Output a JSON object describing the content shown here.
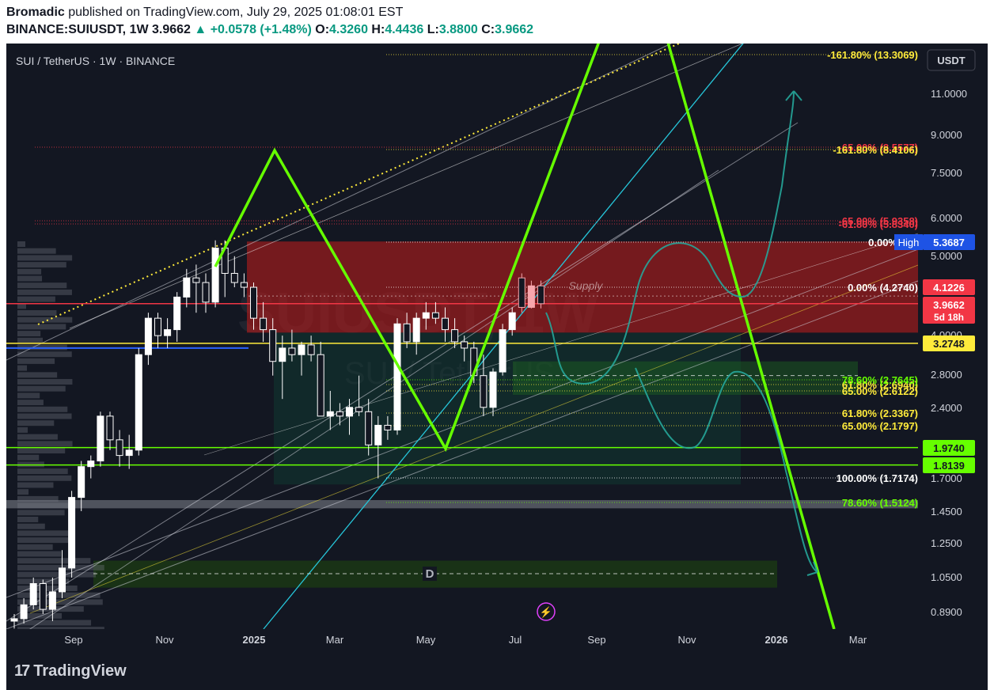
{
  "header": {
    "publisher": "Bromadic",
    "published_text": "published on TradingView.com, July 29, 2025 01:08:01 EST",
    "symbol": "BINANCE:SUIUSDT, 1W",
    "price": "3.9662",
    "change": "+0.0578 (+1.48%)",
    "o_label": "O:",
    "o": "4.3260",
    "h_label": "H:",
    "h": "4.4436",
    "l_label": "L:",
    "l": "3.8800",
    "c_label": "C:",
    "c": "3.9662"
  },
  "chart_title": "SUI / TetherUS · 1W · BINANCE",
  "currency_button": "USDT",
  "watermark": "SUIUSDT, 1W",
  "watermark_sub": "SUI / TetherUS",
  "supply_label": "Supply",
  "d_label": "D",
  "colors": {
    "bg": "#131722",
    "up": "#ffffff",
    "down": "#ffffff",
    "recent_up": "#f7525f",
    "green": "#66ff00",
    "yellow": "#ffeb3b",
    "red": "#f23645",
    "teal": "#26c6da",
    "blue": "#2962ff",
    "text": "#d1d4dc"
  },
  "chart_data": {
    "type": "candlestick",
    "y_scale": "log",
    "ylim": [
      0.85,
      14.0
    ],
    "y_ticks": [
      "11.0000",
      "9.0000",
      "7.5000",
      "6.0000",
      "5.0000",
      "4.0000",
      "2.8000",
      "2.4000",
      "1.7000",
      "1.4500",
      "1.2500",
      "1.0500",
      "0.8900"
    ],
    "x_ticks": [
      "Sep",
      "Nov",
      "2025",
      "Mar",
      "May",
      "Jul",
      "Sep",
      "Nov",
      "2026",
      "Mar"
    ],
    "x_ticks_bold": [
      "2025",
      "2026"
    ],
    "candles": [
      [
        0.85,
        0.88,
        0.82,
        0.86
      ],
      [
        0.86,
        0.95,
        0.84,
        0.92
      ],
      [
        0.92,
        1.05,
        0.9,
        1.02
      ],
      [
        1.02,
        1.04,
        0.88,
        0.9
      ],
      [
        0.9,
        1.05,
        0.85,
        0.98
      ],
      [
        0.98,
        1.2,
        0.95,
        1.1
      ],
      [
        1.1,
        1.6,
        1.05,
        1.55
      ],
      [
        1.55,
        1.85,
        1.45,
        1.8
      ],
      [
        1.8,
        1.9,
        1.7,
        1.85
      ],
      [
        1.85,
        2.35,
        1.8,
        2.3
      ],
      [
        2.3,
        2.35,
        1.95,
        2.05
      ],
      [
        2.05,
        2.15,
        1.8,
        1.9
      ],
      [
        1.9,
        2.1,
        1.78,
        1.95
      ],
      [
        1.95,
        3.2,
        1.9,
        3.1
      ],
      [
        3.1,
        3.8,
        2.95,
        3.7
      ],
      [
        3.7,
        3.8,
        3.2,
        3.4
      ],
      [
        3.4,
        3.7,
        3.2,
        3.5
      ],
      [
        3.5,
        4.2,
        3.3,
        4.1
      ],
      [
        4.1,
        4.7,
        3.9,
        4.5
      ],
      [
        4.5,
        4.8,
        3.8,
        4.4
      ],
      [
        4.4,
        4.6,
        3.8,
        4.0
      ],
      [
        4.0,
        5.4,
        3.9,
        5.2
      ],
      [
        5.2,
        5.4,
        4.1,
        4.6
      ],
      [
        4.6,
        5.0,
        4.3,
        4.4
      ],
      [
        4.4,
        4.6,
        4.1,
        4.3
      ],
      [
        4.3,
        4.4,
        3.5,
        3.7
      ],
      [
        3.7,
        4.0,
        3.3,
        3.5
      ],
      [
        3.5,
        3.7,
        2.8,
        3.0
      ],
      [
        3.0,
        3.4,
        2.5,
        3.2
      ],
      [
        3.2,
        3.5,
        3.0,
        3.1
      ],
      [
        3.1,
        3.3,
        2.8,
        3.25
      ],
      [
        3.25,
        3.4,
        3.0,
        3.1
      ],
      [
        3.1,
        3.3,
        2.5,
        2.3
      ],
      [
        2.3,
        2.6,
        2.15,
        2.35
      ],
      [
        2.35,
        2.45,
        2.2,
        2.3
      ],
      [
        2.3,
        2.5,
        2.1,
        2.4
      ],
      [
        2.4,
        2.8,
        2.3,
        2.35
      ],
      [
        2.35,
        2.5,
        1.9,
        2.0
      ],
      [
        2.0,
        2.3,
        1.7,
        2.2
      ],
      [
        2.2,
        2.3,
        2.05,
        2.15
      ],
      [
        2.15,
        3.7,
        2.1,
        3.6
      ],
      [
        3.6,
        3.8,
        3.2,
        3.3
      ],
      [
        3.3,
        3.8,
        3.1,
        3.7
      ],
      [
        3.7,
        4.0,
        3.5,
        3.8
      ],
      [
        3.8,
        4.0,
        3.6,
        3.7
      ],
      [
        3.7,
        3.9,
        3.3,
        3.5
      ],
      [
        3.5,
        3.7,
        3.2,
        3.3
      ],
      [
        3.3,
        3.4,
        3.0,
        3.2
      ],
      [
        3.2,
        3.3,
        2.7,
        2.8
      ],
      [
        2.8,
        3.1,
        2.3,
        2.4
      ],
      [
        2.4,
        2.9,
        2.3,
        2.85
      ],
      [
        2.85,
        3.6,
        2.8,
        3.5
      ],
      [
        3.5,
        3.9,
        3.4,
        3.8
      ],
      [
        4.5,
        4.6,
        3.8,
        3.9
      ],
      [
        3.9,
        4.44,
        3.88,
        4.33
      ],
      [
        4.33,
        4.44,
        3.88,
        3.97
      ]
    ],
    "price_labels": [
      {
        "text": "5.3687",
        "value": 5.3687,
        "bg": "#1e53e5",
        "tag": "High"
      },
      {
        "text": "4.1226",
        "value": 4.1226,
        "bg": "#f23645",
        "tag": ""
      },
      {
        "text": "3.9662",
        "value": 3.9662,
        "bg": "#f23645",
        "tag": "5d 18h"
      },
      {
        "text": "3.2748",
        "value": 3.2748,
        "bg": "#ffeb3b",
        "tag": ""
      },
      {
        "text": "1.9740",
        "value": 1.974,
        "bg": "#66ff00",
        "tag": ""
      },
      {
        "text": "1.8139",
        "value": 1.8139,
        "bg": "#66ff00",
        "tag": ""
      }
    ],
    "fib_levels": [
      {
        "text": "-161.80% (13.3069)",
        "value": 13.3069,
        "color": "#ffeb3b"
      },
      {
        "text": "-65.00% (8.5577)",
        "value": 8.5577,
        "color": "#f23645"
      },
      {
        "text": "-161.80% (8.4106)",
        "value": 8.4106,
        "color": "#ffeb3b"
      },
      {
        "text": "-65.00% (5.9358)",
        "value": 5.9358,
        "color": "#f23645"
      },
      {
        "text": "-61.80% (5.8340)",
        "value": 5.834,
        "color": "#f23645"
      },
      {
        "text": "0.00% (5.3",
        "value": 5.3687,
        "color": "#ffffff"
      },
      {
        "text": "0.00% (4.2740)",
        "value": 4.274,
        "color": "#ffffff"
      },
      {
        "text": "61.80% (2.6940)",
        "value": 2.694,
        "color": "#ffeb3b"
      },
      {
        "text": "78.60% (2.7645)",
        "value": 2.7645,
        "color": "#66ff00"
      },
      {
        "text": "65.00% (2.6122)",
        "value": 2.6122,
        "color": "#ffeb3b"
      },
      {
        "text": "61.80% (2.3367)",
        "value": 2.3367,
        "color": "#ffeb3b"
      },
      {
        "text": "65.00% (2.1797)",
        "value": 2.1797,
        "color": "#ffeb3b"
      },
      {
        "text": "100.00% (1.7174)",
        "value": 1.7174,
        "color": "#ffffff"
      },
      {
        "text": "78.60% (1.5124)",
        "value": 1.5124,
        "color": "#66ff00"
      }
    ],
    "zigzag": [
      [
        17,
        4.6
      ],
      [
        25,
        8.3
      ],
      [
        40,
        1.95
      ],
      [
        48,
        13.5
      ],
      [
        61,
        3.1
      ],
      [
        75,
        0.4
      ]
    ]
  },
  "footer": {
    "brand": "TradingView"
  }
}
